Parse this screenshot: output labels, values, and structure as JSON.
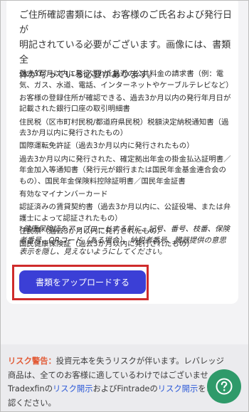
{
  "intro": {
    "line1": "ご住所確認書類には、お客様のご氏名および発行日が",
    "line2": "明記されている必要がございます。画像には、書類全",
    "line3": "体が写っている必要があります。"
  },
  "documents": [
    "過去3か月以内に発行された最近の公共料金の請求書（例：電気、ガス、水道、電話、インターネットやケーブルテレビなど）",
    "お客様の登録住所が確認できる、過去3か月以内の発行年月日が記載された銀行口座の取引明細書",
    "住民税（区市町村民税/都道府県民税）税額決定納税通知書（過去3か月以内に発行されたもの）",
    "国際運転免許証（過去3か月以内に発行されたもの）",
    "過去3か月以内に発行された、確定拠出年金の掛金払込証明書／年金加入等通知書（発行元が銀行または国民年金基金連合会のもの）、国民年金保険料控除証明書／国民年金証書",
    "有効なマイナンバーカード",
    "認証済みの賃貸契約書（過去3か月以内に、公証役場、または弁護士によって認証されたもの）",
    "住民票（過去3か月以内に発行されたもの）",
    "国民健康保険証（過去3か月以内に発行されたもの）"
  ],
  "note": "*健康保険証をアップロードする前に、記号、番号、枝番、保険者番号、QRコード（ある場合）、納税者番号、臓器提供の意思表示を隠し、見えないようにしてください。",
  "upload_button": "書類をアップロードする",
  "risk": {
    "label": "リスク警告：",
    "text1": "投資元本を失うリスクが伴います。レバレッジ商品は、全てのお客様に適しているわけではございませ",
    "text2": "Tradexfinの",
    "link1": "リスク開示",
    "text3": "およびFintradeの",
    "link2": "リスク開示",
    "text4": "をご確認ください。"
  },
  "help_icon": "help-question-icon",
  "colors": {
    "button": "#3b3fd6",
    "highlight_border": "#cf2b2b",
    "risk_label": "#e25b37",
    "link": "#2e5bd8",
    "fab": "#2f9a6a"
  }
}
